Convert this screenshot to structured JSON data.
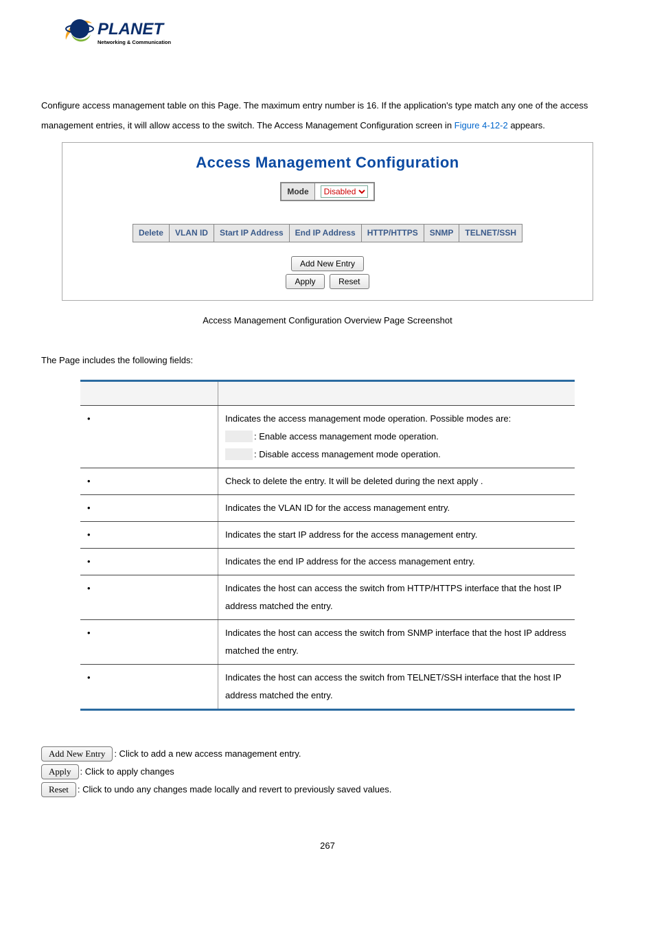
{
  "logo": {
    "brand": "PLANET",
    "tagline": "Networking & Communication"
  },
  "intro": {
    "text_before_link": "Configure access management table on this Page. The maximum entry number is 16. If the application's type match any one of the access management entries, it will allow access to the switch. The Access Management Configuration screen in ",
    "link": "Figure 4-12-2",
    "text_after_link": " appears."
  },
  "config_box": {
    "title": "Access Management Configuration",
    "mode_label": "Mode",
    "mode_value": "Disabled",
    "columns": [
      "Delete",
      "VLAN ID",
      "Start IP Address",
      "End IP Address",
      "HTTP/HTTPS",
      "SNMP",
      "TELNET/SSH"
    ],
    "btn_add": "Add New Entry",
    "btn_apply": "Apply",
    "btn_reset": "Reset"
  },
  "caption": "Access Management Configuration Overview Page Screenshot",
  "fields_intro": "The Page includes the following fields:",
  "fields_table": {
    "rows": [
      {
        "object": "",
        "desc_main": "Indicates the access management mode operation. Possible modes are:",
        "opts": [
          {
            "label": "",
            "text": ": Enable access management mode operation."
          },
          {
            "label": "",
            "text": ": Disable access management mode operation."
          }
        ]
      },
      {
        "object": "",
        "desc_main": "Check to delete the entry. It will be deleted during the next apply ."
      },
      {
        "object": "",
        "desc_main": "Indicates the VLAN ID for the access management entry."
      },
      {
        "object": "",
        "desc_main": "Indicates the start IP address for the access management entry."
      },
      {
        "object": "",
        "desc_main": "Indicates the end IP address for the access management entry."
      },
      {
        "object": "",
        "desc_main": "Indicates the host can access the switch from HTTP/HTTPS interface that the host IP address matched the entry."
      },
      {
        "object": "",
        "desc_main": "Indicates the host can access the switch from SNMP interface that the host IP address matched the entry."
      },
      {
        "object": "",
        "desc_main": "Indicates the host can access the switch from TELNET/SSH interface that the host IP address matched the entry."
      }
    ]
  },
  "buttons_section": {
    "items": [
      {
        "btn": "Add New Entry",
        "text": ": Click to add a new access management entry."
      },
      {
        "btn": "Apply",
        "text": ": Click to apply changes"
      },
      {
        "btn": "Reset",
        "text": ": Click to undo any changes made locally and revert to previously saved values."
      }
    ]
  },
  "page_number": "267"
}
